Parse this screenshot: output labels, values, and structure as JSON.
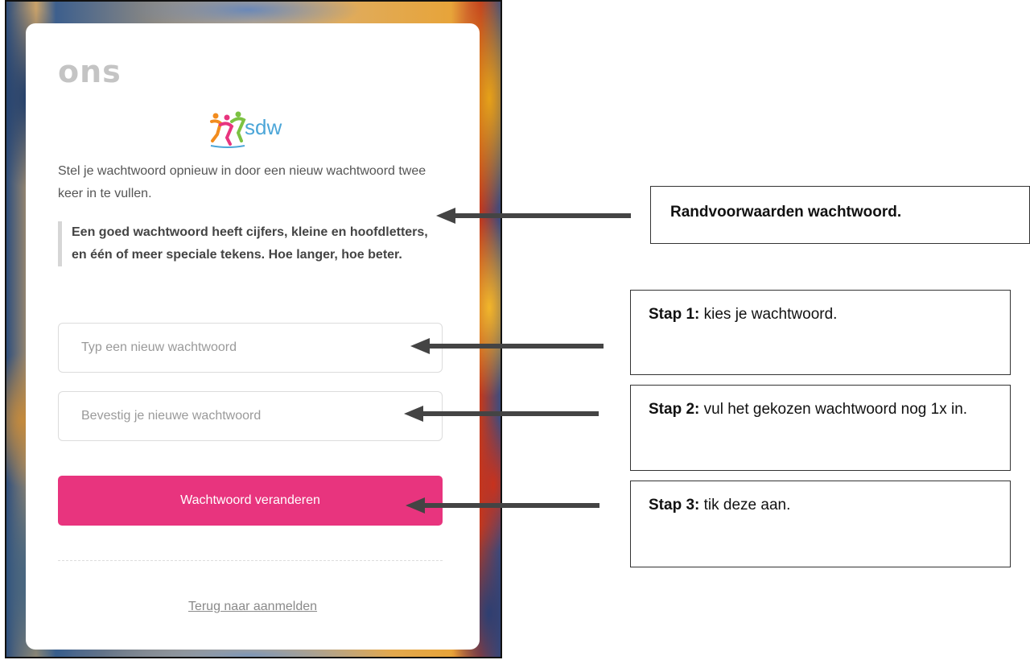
{
  "card": {
    "brand": "ons",
    "logo_text": "sdw",
    "intro": "Stel je wachtwoord opnieuw in door een nieuw wachtwoord twee keer in te vullen.",
    "rules": "Een goed wachtwoord heeft cijfers, kleine en hoofdletters, en één of meer speciale tekens. Hoe langer, hoe beter.",
    "new_password": {
      "value": "",
      "placeholder": "Typ een nieuw wachtwoord"
    },
    "confirm_password": {
      "value": "",
      "placeholder": "Bevestig je nieuwe wachtwoord"
    },
    "submit_label": "Wachtwoord veranderen",
    "back_link": "Terug naar aanmelden"
  },
  "callouts": [
    {
      "title": "Randvoorwaarden wachtwoord."
    },
    {
      "step": "Stap 1:",
      "text": " kies je wachtwoord."
    },
    {
      "step": "Stap 2:",
      "text": " vul het gekozen wachtwoord nog 1x in."
    },
    {
      "step": "Stap 3:",
      "text": " tik deze aan."
    }
  ],
  "colors": {
    "accent": "#e8347e",
    "arrow": "#444444",
    "brand_grey": "#c4c4c4"
  },
  "icons": {
    "logo": "sdw-dancers-logo-icon"
  }
}
